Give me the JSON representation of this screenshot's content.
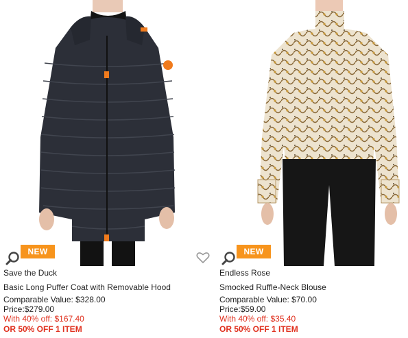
{
  "colors": {
    "badge": "#f7941d",
    "promo": "#e0301e",
    "text": "#222222"
  },
  "products": [
    {
      "badge": "NEW",
      "brand": "Save the Duck",
      "name": "Basic Long Puffer Coat with Removable Hood",
      "comparable": "Comparable Value: $328.00",
      "price": "Price:$279.00",
      "promo_pct": "With 40% off: $167.40",
      "promo_item": "OR 50% OFF 1 ITEM",
      "icons": [
        "search-icon"
      ]
    },
    {
      "badge": "NEW",
      "brand": "Endless Rose",
      "name": "Smocked Ruffle-Neck Blouse",
      "comparable": "Comparable Value: $70.00",
      "price": "Price:$59.00",
      "promo_pct": "With 40% off: $35.40",
      "promo_item": "OR 50% OFF 1 ITEM",
      "icons": [
        "search-icon"
      ]
    }
  ],
  "wishlist_icon": "heart-icon"
}
